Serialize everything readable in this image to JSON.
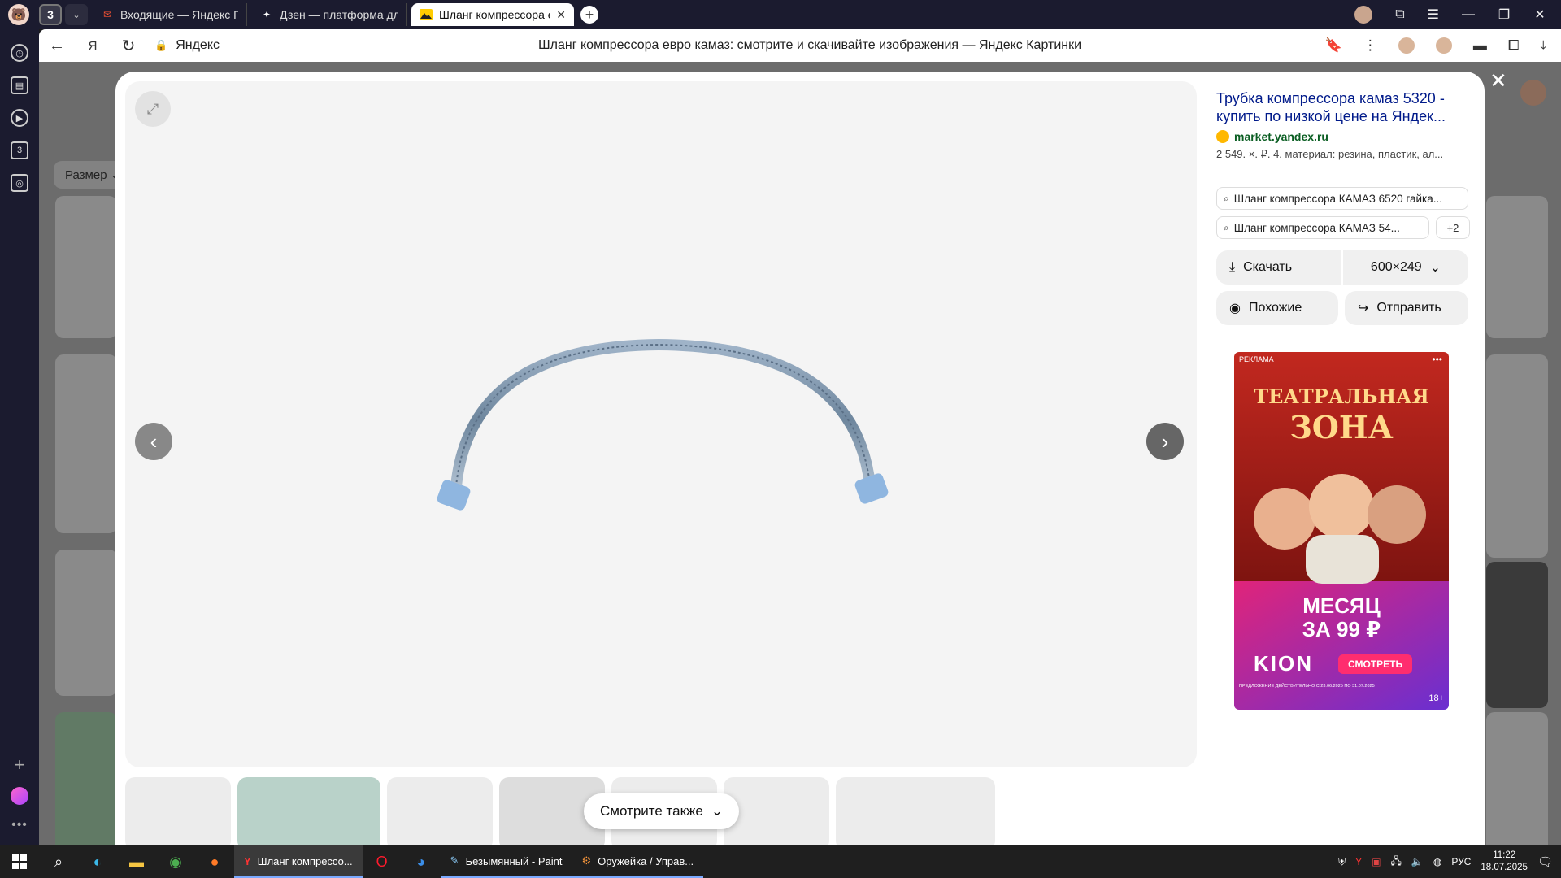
{
  "browser": {
    "tab_count": "3",
    "tabs": [
      {
        "title": "Входящие — Яндекс Почта",
        "favicon": "mail-icon"
      },
      {
        "title": "Дзен — платформа для просмотра",
        "favicon": "zen-icon"
      },
      {
        "title": "Шланг компрессора евро камаз",
        "favicon": "yandex-images-icon",
        "active": true
      }
    ],
    "address": {
      "site": "Яндекс",
      "title": "Шланг компрессора евро камаз: смотрите и скачивайте изображения — Яндекс Картинки"
    }
  },
  "page": {
    "filter_label": "Размер"
  },
  "viewer": {
    "result_title": "Трубка компрессора камаз 5320 - купить по низкой цене на Яндек...",
    "source": "market.yandex.ru",
    "snippet": "2 549. ×. ₽. 4. материал: резина, пластик, ал...",
    "chips": [
      "Шланг компрессора КАМАЗ 6520 гайка...",
      "Шланг компрессора КАМАЗ 54..."
    ],
    "chips_more": "+2",
    "download_label": "Скачать",
    "size_label": "600×249",
    "similar_label": "Похожие",
    "share_label": "Отправить",
    "see_also_label": "Смотрите также"
  },
  "ad": {
    "tag": "РЕКЛАМА",
    "headline_1": "ТЕАТРАЛЬНАЯ",
    "headline_2": "ЗОНА",
    "offer_1": "МЕСЯЦ",
    "offer_2": "ЗА 99 ₽",
    "brand": "KION",
    "cta": "СМОТРЕТЬ",
    "age": "18+",
    "fineprint": "ПРЕДЛОЖЕНИЕ ДЕЙСТВИТЕЛЬНО С 23.06.2025 ПО 31.07.2025"
  },
  "taskbar": {
    "apps": [
      {
        "label": "Шланг компрессо...",
        "icon": "yandex-browser-icon",
        "state": "active"
      },
      {
        "label": "Безымянный - Paint",
        "icon": "paint-icon",
        "state": "running"
      },
      {
        "label": "Оружейка / Управ...",
        "icon": "game-icon",
        "state": "running"
      }
    ],
    "lang": "РУС",
    "time": "11:22",
    "date": "18.07.2025"
  }
}
